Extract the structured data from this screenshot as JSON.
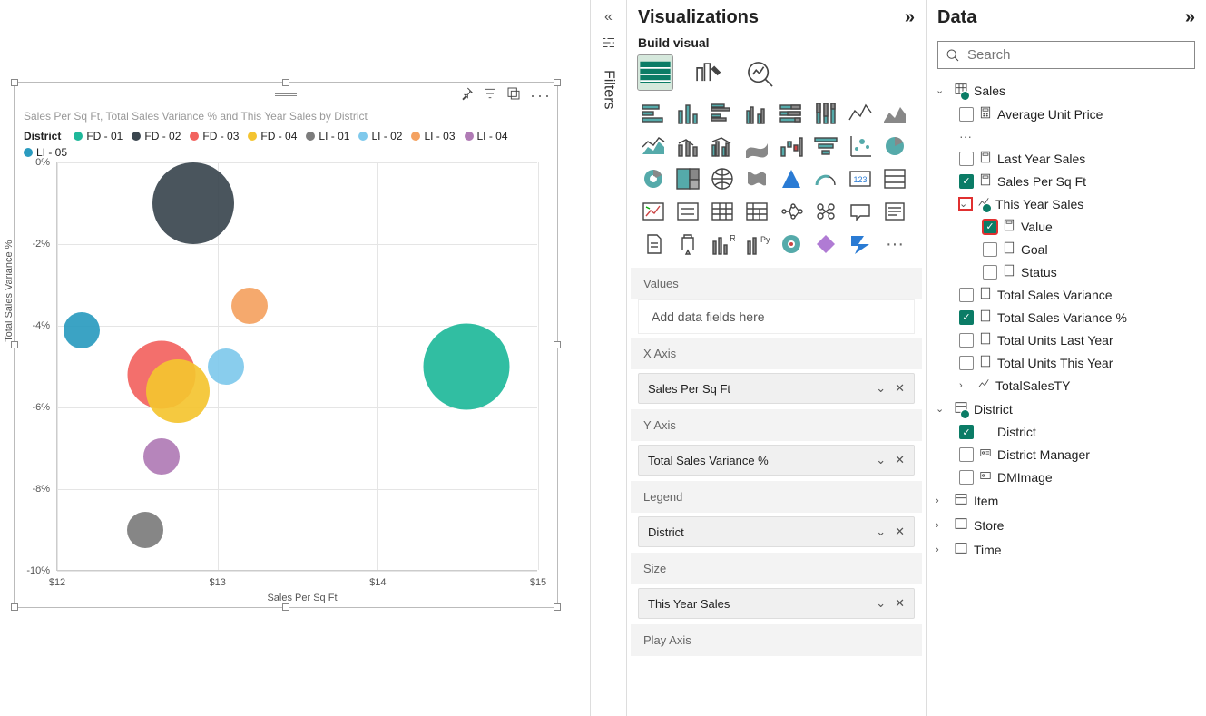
{
  "panes": {
    "filters": "Filters",
    "visualizations": "Visualizations",
    "build_visual": "Build visual",
    "data": "Data"
  },
  "search": {
    "placeholder": "Search"
  },
  "viz": {
    "title": "Sales Per Sq Ft, Total Sales Variance % and This Year Sales by District",
    "legend_title": "District",
    "xaxis_label": "Sales Per Sq Ft",
    "yaxis_label": "Total Sales Variance %"
  },
  "wells": {
    "values_label": "Values",
    "values_placeholder": "Add data fields here",
    "xaxis_label": "X Axis",
    "xaxis_value": "Sales Per Sq Ft",
    "yaxis_label": "Y Axis",
    "yaxis_value": "Total Sales Variance %",
    "legend_label": "Legend",
    "legend_value": "District",
    "size_label": "Size",
    "size_value": "This Year Sales",
    "play_label": "Play Axis"
  },
  "tree": {
    "sales": "Sales",
    "avg_unit_price": "Average Unit Price",
    "last_year_sales": "Last Year Sales",
    "sales_per_sqft": "Sales Per Sq Ft",
    "this_year_sales": "This Year Sales",
    "value": "Value",
    "goal": "Goal",
    "status": "Status",
    "total_sales_variance": "Total Sales Variance",
    "total_sales_variance_pct": "Total Sales Variance %",
    "total_units_last_year": "Total Units Last Year",
    "total_units_this_year": "Total Units This Year",
    "total_sales_ty": "TotalSalesTY",
    "district": "District",
    "district_field": "District",
    "district_manager": "District Manager",
    "dm_image": "DMImage",
    "item": "Item",
    "store": "Store",
    "time": "Time"
  },
  "chart_data": {
    "type": "scatter",
    "title": "Sales Per Sq Ft, Total Sales Variance % and This Year Sales by District",
    "xlabel": "Sales Per Sq Ft",
    "ylabel": "Total Sales Variance %",
    "xlim": [
      12,
      15
    ],
    "ylim": [
      -10,
      0
    ],
    "xticks": [
      "$12",
      "$13",
      "$14",
      "$15"
    ],
    "yticks": [
      "0%",
      "-2%",
      "-4%",
      "-6%",
      "-8%",
      "-10%"
    ],
    "series": [
      {
        "name": "FD - 01",
        "color": "#1fb89a",
        "x": 14.55,
        "y": -5.0,
        "size": 95
      },
      {
        "name": "FD - 02",
        "color": "#3b464f",
        "x": 12.85,
        "y": -1.0,
        "size": 90
      },
      {
        "name": "FD - 03",
        "color": "#f2635f",
        "x": 12.65,
        "y": -5.2,
        "size": 75
      },
      {
        "name": "FD - 04",
        "color": "#f4c430",
        "x": 12.75,
        "y": -5.6,
        "size": 70
      },
      {
        "name": "LI - 01",
        "color": "#7c7c7c",
        "x": 12.55,
        "y": -9.0,
        "size": 40
      },
      {
        "name": "LI - 02",
        "color": "#7fc9ec",
        "x": 13.05,
        "y": -5.0,
        "size": 40
      },
      {
        "name": "LI - 03",
        "color": "#f4a261",
        "x": 13.2,
        "y": -3.5,
        "size": 40
      },
      {
        "name": "LI - 04",
        "color": "#b07bb5",
        "x": 12.65,
        "y": -7.2,
        "size": 40
      },
      {
        "name": "LI - 05",
        "color": "#2a9bbf",
        "x": 12.15,
        "y": -4.1,
        "size": 40
      }
    ]
  }
}
